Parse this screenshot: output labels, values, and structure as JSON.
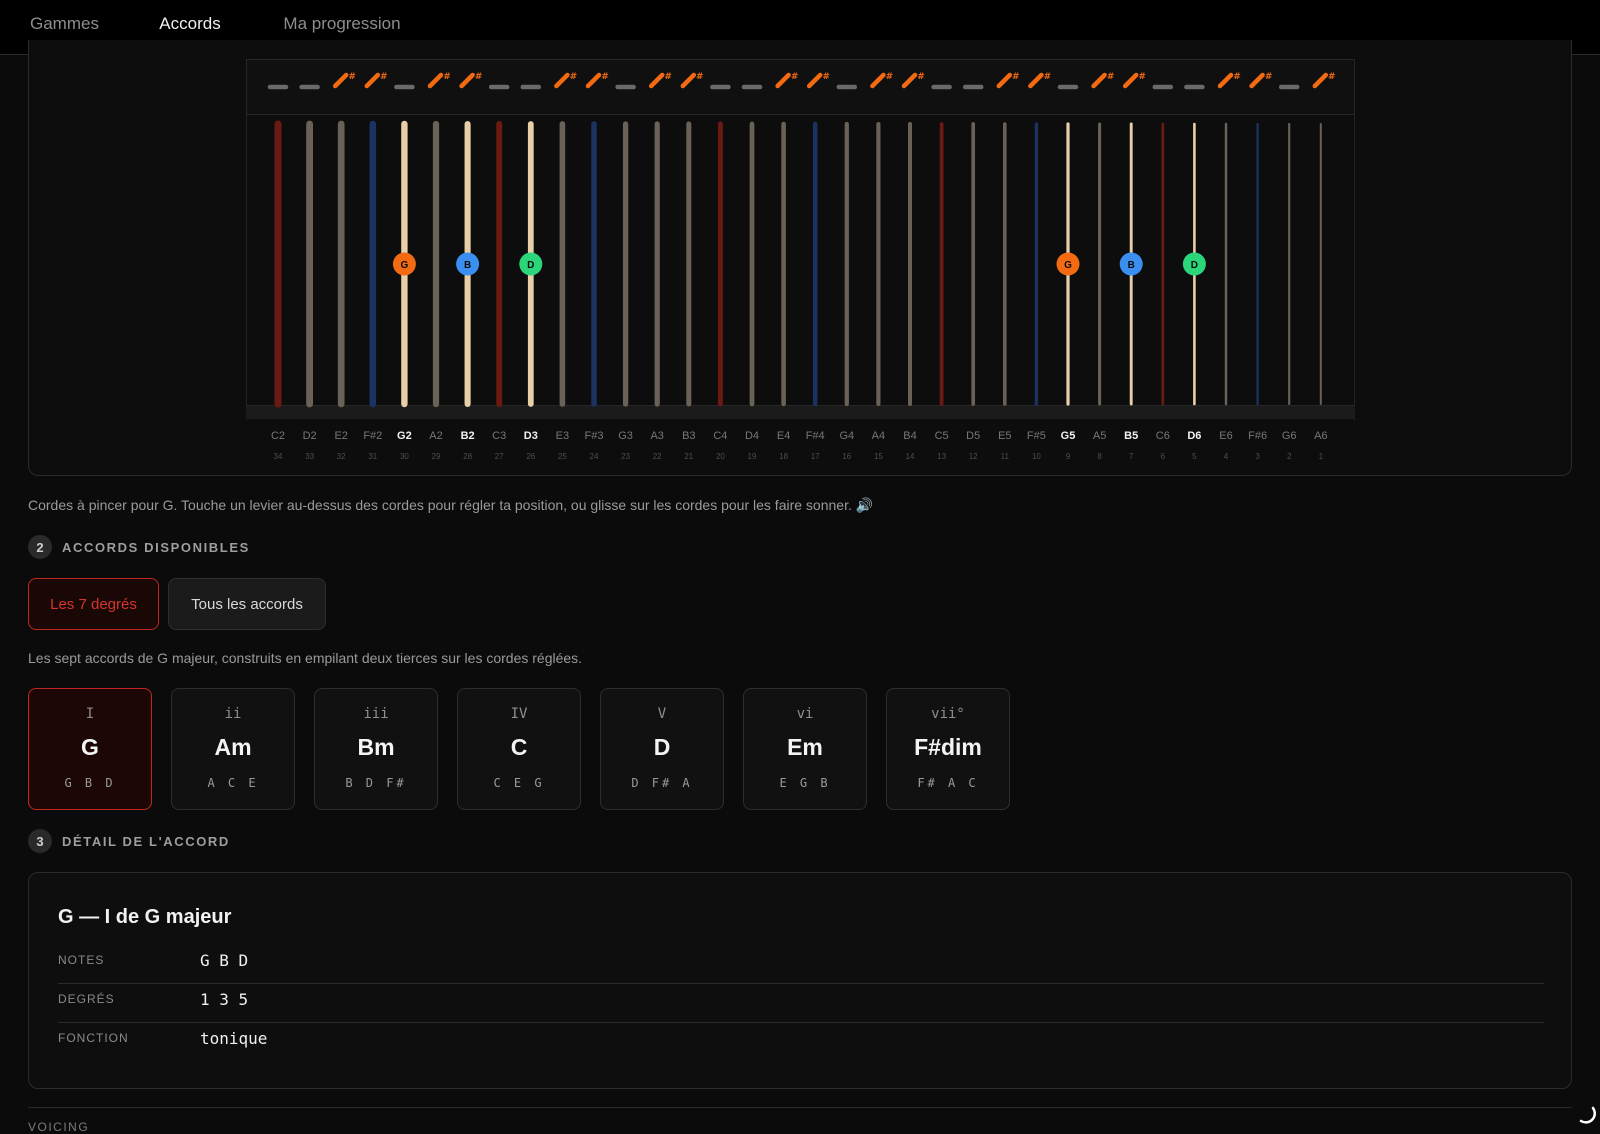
{
  "tabs": [
    {
      "label": "Gammes",
      "active": false
    },
    {
      "label": "Accords",
      "active": true
    },
    {
      "label": "Ma progression",
      "active": false
    }
  ],
  "harp": {
    "strings": [
      {
        "note": "C2",
        "num": "34",
        "color": "red"
      },
      {
        "note": "D2",
        "num": "33",
        "color": "plain"
      },
      {
        "note": "E2",
        "num": "32",
        "color": "plain"
      },
      {
        "note": "F#2",
        "num": "31",
        "color": "blue"
      },
      {
        "note": "G2",
        "num": "30",
        "color": "plain",
        "chord": "G"
      },
      {
        "note": "A2",
        "num": "29",
        "color": "plain"
      },
      {
        "note": "B2",
        "num": "28",
        "color": "plain",
        "chord": "B"
      },
      {
        "note": "C3",
        "num": "27",
        "color": "red"
      },
      {
        "note": "D3",
        "num": "26",
        "color": "plain",
        "chord": "D"
      },
      {
        "note": "E3",
        "num": "25",
        "color": "plain"
      },
      {
        "note": "F#3",
        "num": "24",
        "color": "blue"
      },
      {
        "note": "G3",
        "num": "23",
        "color": "plain"
      },
      {
        "note": "A3",
        "num": "22",
        "color": "plain"
      },
      {
        "note": "B3",
        "num": "21",
        "color": "plain"
      },
      {
        "note": "C4",
        "num": "20",
        "color": "red"
      },
      {
        "note": "D4",
        "num": "19",
        "color": "plain"
      },
      {
        "note": "E4",
        "num": "18",
        "color": "plain"
      },
      {
        "note": "F#4",
        "num": "17",
        "color": "blue"
      },
      {
        "note": "G4",
        "num": "16",
        "color": "plain"
      },
      {
        "note": "A4",
        "num": "15",
        "color": "plain"
      },
      {
        "note": "B4",
        "num": "14",
        "color": "plain"
      },
      {
        "note": "C5",
        "num": "13",
        "color": "red"
      },
      {
        "note": "D5",
        "num": "12",
        "color": "plain"
      },
      {
        "note": "E5",
        "num": "11",
        "color": "plain"
      },
      {
        "note": "F#5",
        "num": "10",
        "color": "blue"
      },
      {
        "note": "G5",
        "num": "9",
        "color": "plain",
        "chord": "G"
      },
      {
        "note": "A5",
        "num": "8",
        "color": "plain"
      },
      {
        "note": "B5",
        "num": "7",
        "color": "plain",
        "chord": "B"
      },
      {
        "note": "C6",
        "num": "6",
        "color": "red"
      },
      {
        "note": "D6",
        "num": "5",
        "color": "plain",
        "chord": "D"
      },
      {
        "note": "E6",
        "num": "4",
        "color": "plain"
      },
      {
        "note": "F#6",
        "num": "3",
        "color": "blue"
      },
      {
        "note": "G6",
        "num": "2",
        "color": "plain"
      },
      {
        "note": "A6",
        "num": "1",
        "color": "plain"
      }
    ],
    "levers": [
      "flat",
      "flat",
      "sharp",
      "sharp",
      "flat",
      "sharp",
      "sharp",
      "flat",
      "flat",
      "sharp",
      "sharp",
      "flat",
      "sharp",
      "sharp",
      "flat",
      "flat",
      "sharp",
      "sharp",
      "flat",
      "sharp",
      "sharp",
      "flat",
      "flat",
      "sharp",
      "sharp",
      "flat",
      "sharp",
      "sharp",
      "flat",
      "flat",
      "sharp",
      "sharp",
      "flat",
      "sharp"
    ],
    "sharp_symbol": "#",
    "note_colors": {
      "G": "#f26a12",
      "B": "#3b8ff0",
      "D": "#2bd67b"
    },
    "string_colors": {
      "red": "#6a1a12",
      "blue": "#1c3260",
      "plain": "#6b6257",
      "active": "#e8cfa8"
    },
    "lever_color": "#f26a12"
  },
  "hint_text": "Cordes à pincer pour G. Touche un levier au-dessus des cordes pour régler ta position, ou glisse sur les cordes pour les faire sonner. 🔊",
  "section2": {
    "num": "2",
    "title": "ACCORDS DISPONIBLES"
  },
  "filters": {
    "selected": "Les 7 degrés",
    "other": "Tous les accords"
  },
  "chords_desc": "Les sept accords de G majeur, construits en empilant deux tierces sur les cordes réglées.",
  "chords": [
    {
      "degree": "I",
      "name": "G",
      "notes": "G B D"
    },
    {
      "degree": "ii",
      "name": "Am",
      "notes": "A C E"
    },
    {
      "degree": "iii",
      "name": "Bm",
      "notes": "B D F#"
    },
    {
      "degree": "IV",
      "name": "C",
      "notes": "C E G"
    },
    {
      "degree": "V",
      "name": "D",
      "notes": "D F# A"
    },
    {
      "degree": "vi",
      "name": "Em",
      "notes": "E G B"
    },
    {
      "degree": "vii°",
      "name": "F#dim",
      "notes": "F# A C"
    }
  ],
  "section3": {
    "num": "3",
    "title": "DÉTAIL DE L'ACCORD"
  },
  "detail": {
    "title": "G — I de G majeur",
    "rows": [
      {
        "key": "NOTES",
        "value": "G B D"
      },
      {
        "key": "DEGRÉS",
        "value": "1 3 5"
      },
      {
        "key": "FONCTION",
        "value": "tonique"
      }
    ]
  },
  "bottom_label": "VOICING",
  "accent": "#c0281e"
}
